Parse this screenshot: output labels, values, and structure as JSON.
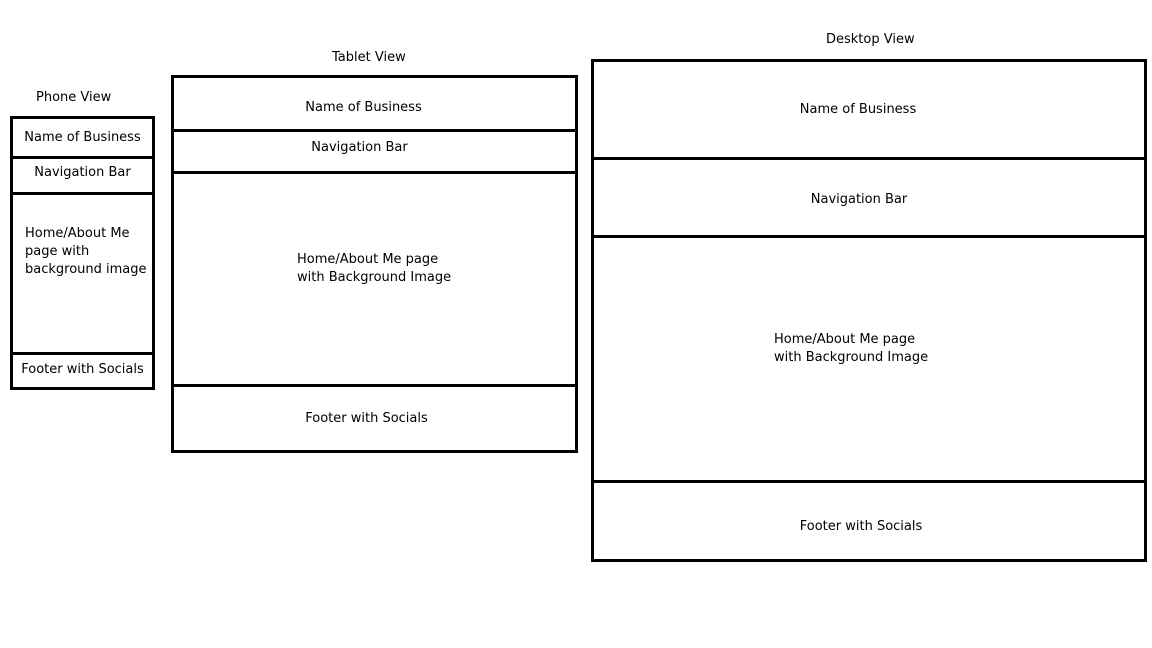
{
  "phone": {
    "title": "Phone View",
    "header": "Name of Business",
    "nav": "Navigation Bar",
    "main": "Home/About Me\npage with\nbackground image",
    "footer": "Footer with Socials"
  },
  "tablet": {
    "title": "Tablet View",
    "header": "Name of Business",
    "nav": "Navigation Bar",
    "main": "Home/About Me page\nwith Background Image",
    "footer": "Footer with Socials"
  },
  "desktop": {
    "title": "Desktop View",
    "header": "Name of Business",
    "nav": "Navigation Bar",
    "main": "Home/About Me page\nwith Background Image",
    "footer": "Footer with Socials"
  }
}
